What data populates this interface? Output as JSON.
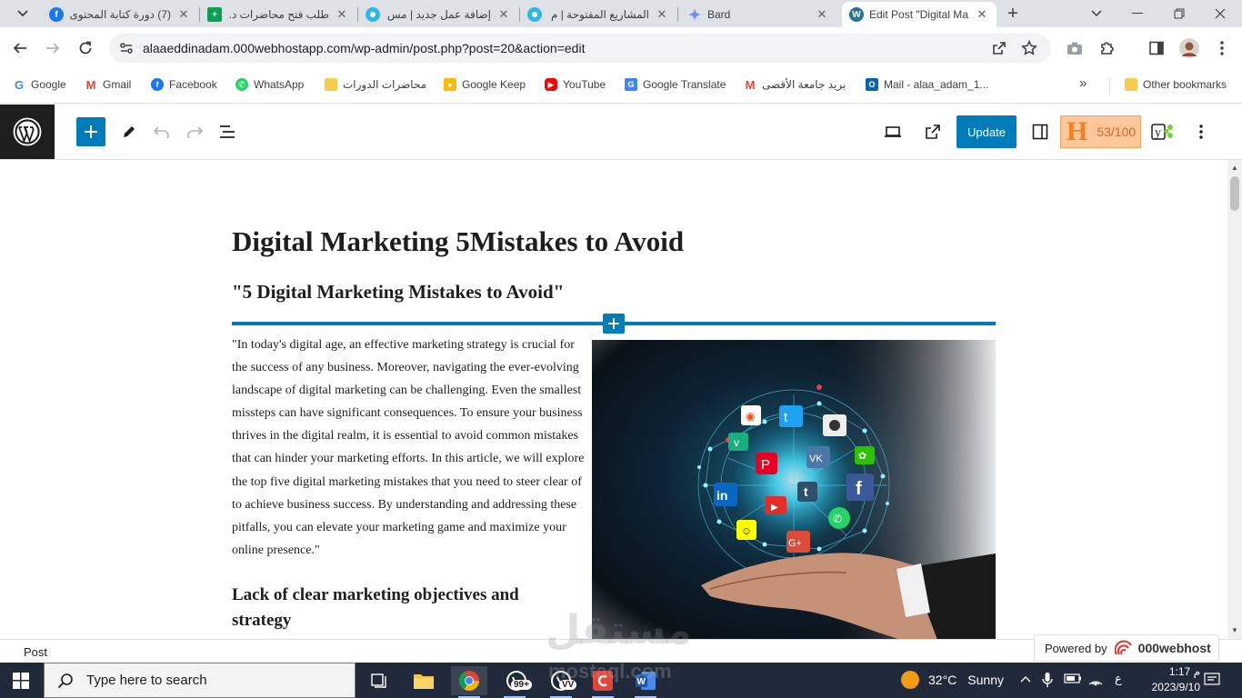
{
  "browser": {
    "tabs": [
      {
        "title": "(7) دورة كتابة المحتوى",
        "favicon": "facebook-icon",
        "color": "#1877f2"
      },
      {
        "title": "طلب فتح محاضرات د.",
        "favicon": "sheets-icon",
        "color": "#0f9d58"
      },
      {
        "title": "إضافة عمل جديد | مس",
        "favicon": "mostaql-icon",
        "color": "#2db8e8"
      },
      {
        "title": "المشاريع المفتوحة | م",
        "favicon": "mostaql-icon",
        "color": "#2db8e8"
      },
      {
        "title": "Bard",
        "favicon": "bard-icon",
        "color": "#6b8cff"
      },
      {
        "title": "Edit Post \"Digital Ma",
        "favicon": "wordpress-icon",
        "color": "#21759b"
      }
    ],
    "url": "alaaeddinadam.000webhostapp.com/wp-admin/post.php?post=20&action=edit",
    "bookmarks": [
      {
        "label": "Google",
        "icon": "google-icon",
        "color": "#4285f4"
      },
      {
        "label": "Gmail",
        "icon": "gmail-icon",
        "color": "#ea4335"
      },
      {
        "label": "Facebook",
        "icon": "facebook-icon",
        "color": "#1877f2"
      },
      {
        "label": "WhatsApp",
        "icon": "whatsapp-icon",
        "color": "#25d366"
      },
      {
        "label": "محاضرات الدورات",
        "icon": "folder-icon",
        "color": "#f7cb4d"
      },
      {
        "label": "Google Keep",
        "icon": "keep-icon",
        "color": "#fbbc04"
      },
      {
        "label": "YouTube",
        "icon": "youtube-icon",
        "color": "#ff0000"
      },
      {
        "label": "Google Translate",
        "icon": "translate-icon",
        "color": "#4285f4"
      },
      {
        "label": "بريد جامعة الأقصى",
        "icon": "gmail-icon",
        "color": "#ea4335"
      },
      {
        "label": "Mail - alaa_adam_1...",
        "icon": "outlook-icon",
        "color": "#0a64ad"
      }
    ],
    "more_bookmarks": "»",
    "other_bookmarks": "Other bookmarks"
  },
  "editor": {
    "update_label": "Update",
    "seo_score": "53/100",
    "post": {
      "title": "Digital Marketing 5Mistakes to Avoid",
      "subtitle": "\"5 Digital Marketing Mistakes to Avoid\"",
      "intro": "\"In today's digital age, an effective marketing strategy is crucial for the success of any business. Moreover, navigating the ever-evolving landscape of digital marketing can be challenging. Even the smallest missteps can have significant consequences. To ensure your business thrives in the digital realm, it is essential to avoid common mistakes that can hinder your marketing efforts. In this article, we will explore the top five digital marketing mistakes that you need to steer clear of to achieve business success. By understanding and addressing these pitfalls, you can elevate your marketing game and maximize your online presence.\"",
      "heading": "Lack of clear marketing objectives and strategy"
    },
    "breadcrumb": "Post",
    "powered_by": "Powered by",
    "host_brand": "000webhost"
  },
  "taskbar": {
    "search_placeholder": "Type here to search",
    "whatsapp_badge": "99+",
    "whatsapp2_badge": "VV",
    "temperature": "32°C",
    "weather": "Sunny",
    "lang": "ع",
    "time": "1:17 م",
    "date": "2023/9/10"
  },
  "watermark": {
    "arabic": "مستقل",
    "latin": "mostaql.com"
  }
}
